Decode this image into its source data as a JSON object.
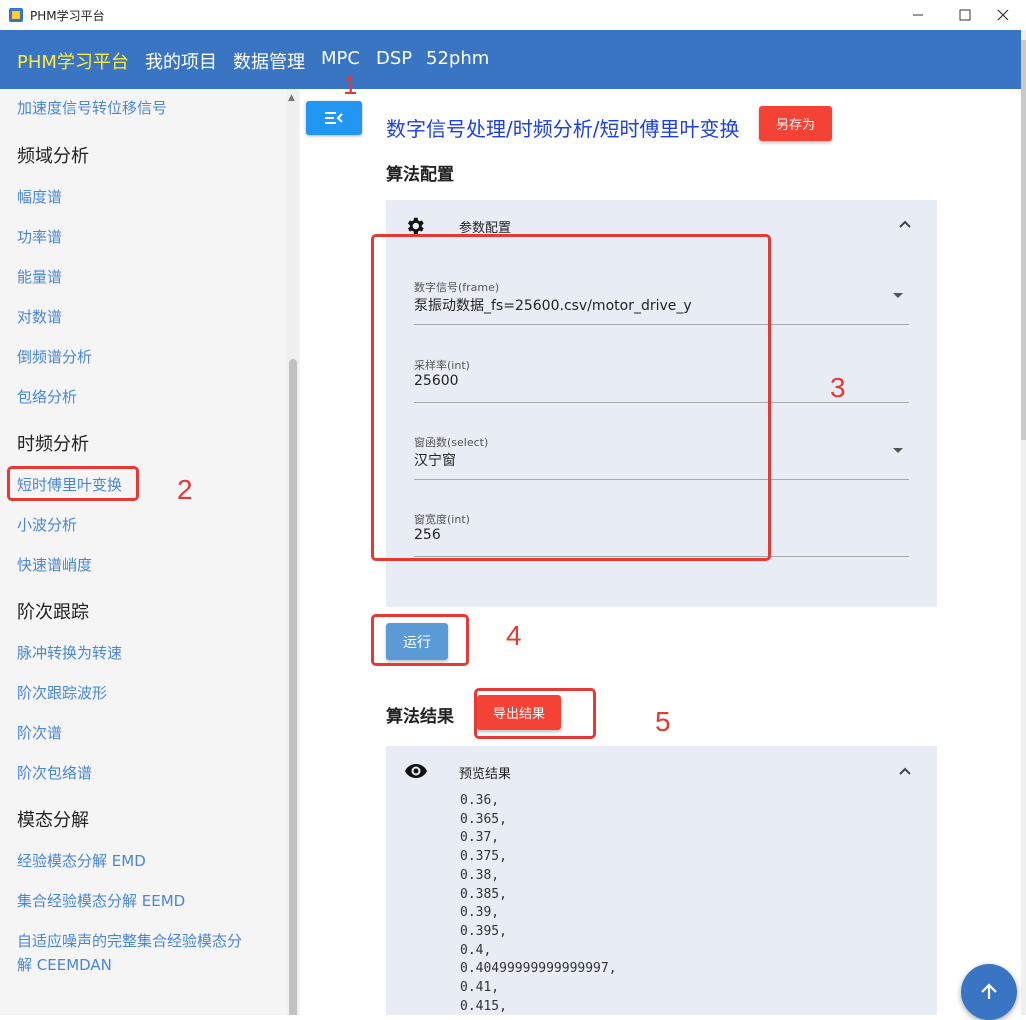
{
  "window": {
    "title": "PHM学习平台",
    "minimize_icon": "minimize-icon",
    "maximize_icon": "maximize-icon",
    "close_icon": "close-icon"
  },
  "appbar": {
    "brand": "PHM学习平台",
    "nav": [
      "我的项目",
      "数据管理",
      "MPC",
      "DSP",
      "52phm"
    ],
    "brand_color": "#ffeb3b",
    "bg_color": "#3a75c4"
  },
  "annotations": [
    "1",
    "2",
    "3",
    "4",
    "5"
  ],
  "sidebar": {
    "items": [
      {
        "type": "link",
        "label": "加速度信号转位移信号"
      },
      {
        "type": "head",
        "label": "频域分析"
      },
      {
        "type": "link",
        "label": "幅度谱"
      },
      {
        "type": "link",
        "label": "功率谱"
      },
      {
        "type": "link",
        "label": "能量谱"
      },
      {
        "type": "link",
        "label": "对数谱"
      },
      {
        "type": "link",
        "label": "倒频谱分析"
      },
      {
        "type": "link",
        "label": "包络分析"
      },
      {
        "type": "head",
        "label": "时频分析"
      },
      {
        "type": "link",
        "label": "短时傅里叶变换"
      },
      {
        "type": "link",
        "label": "小波分析"
      },
      {
        "type": "link",
        "label": "快速谱峭度"
      },
      {
        "type": "head",
        "label": "阶次跟踪"
      },
      {
        "type": "link",
        "label": "脉冲转换为转速"
      },
      {
        "type": "link",
        "label": "阶次跟踪波形"
      },
      {
        "type": "link",
        "label": "阶次谱"
      },
      {
        "type": "link",
        "label": "阶次包络谱"
      },
      {
        "type": "head",
        "label": "模态分解"
      },
      {
        "type": "link",
        "label": "经验模态分解 EMD"
      },
      {
        "type": "link",
        "label": "集合经验模态分解 EEMD"
      },
      {
        "type": "link",
        "label": "自适应噪声的完整集合经验模态分"
      },
      {
        "type": "link",
        "label": "解 CEEMDAN"
      }
    ],
    "link_color": "#4a86d6"
  },
  "main": {
    "breadcrumb": "数字信号处理/时频分析/短时傅里叶变换",
    "save_as": "另存为",
    "config_title": "算法配置",
    "config_panel": {
      "label": "参数配置",
      "icon": "gear-icon",
      "fields": [
        {
          "label": "数字信号(frame)",
          "value": "泵振动数据_fs=25600.csv/motor_drive_y",
          "dropdown": true
        },
        {
          "label": "采样率(int)",
          "value": "25600",
          "dropdown": false
        },
        {
          "label": "窗函数(select)",
          "value": "汉宁窗",
          "dropdown": true
        },
        {
          "label": "窗宽度(int)",
          "value": "256",
          "dropdown": false
        }
      ]
    },
    "run_label": "运行",
    "result_title": "算法结果",
    "export_label": "导出结果",
    "result_panel": {
      "label": "预览结果",
      "icon": "eye-icon",
      "lines": [
        "0.36,",
        "0.365,",
        "0.37,",
        "0.375,",
        "0.38,",
        "0.385,",
        "0.39,",
        "0.395,",
        "0.4,",
        "0.40499999999999997,",
        "0.41,",
        "0.415,"
      ]
    }
  },
  "colors": {
    "accent_red": "#f44336",
    "run_blue": "#5b9bd5",
    "breadcrumb_blue": "#1e40e0",
    "panel_bg": "#e8edf5"
  }
}
